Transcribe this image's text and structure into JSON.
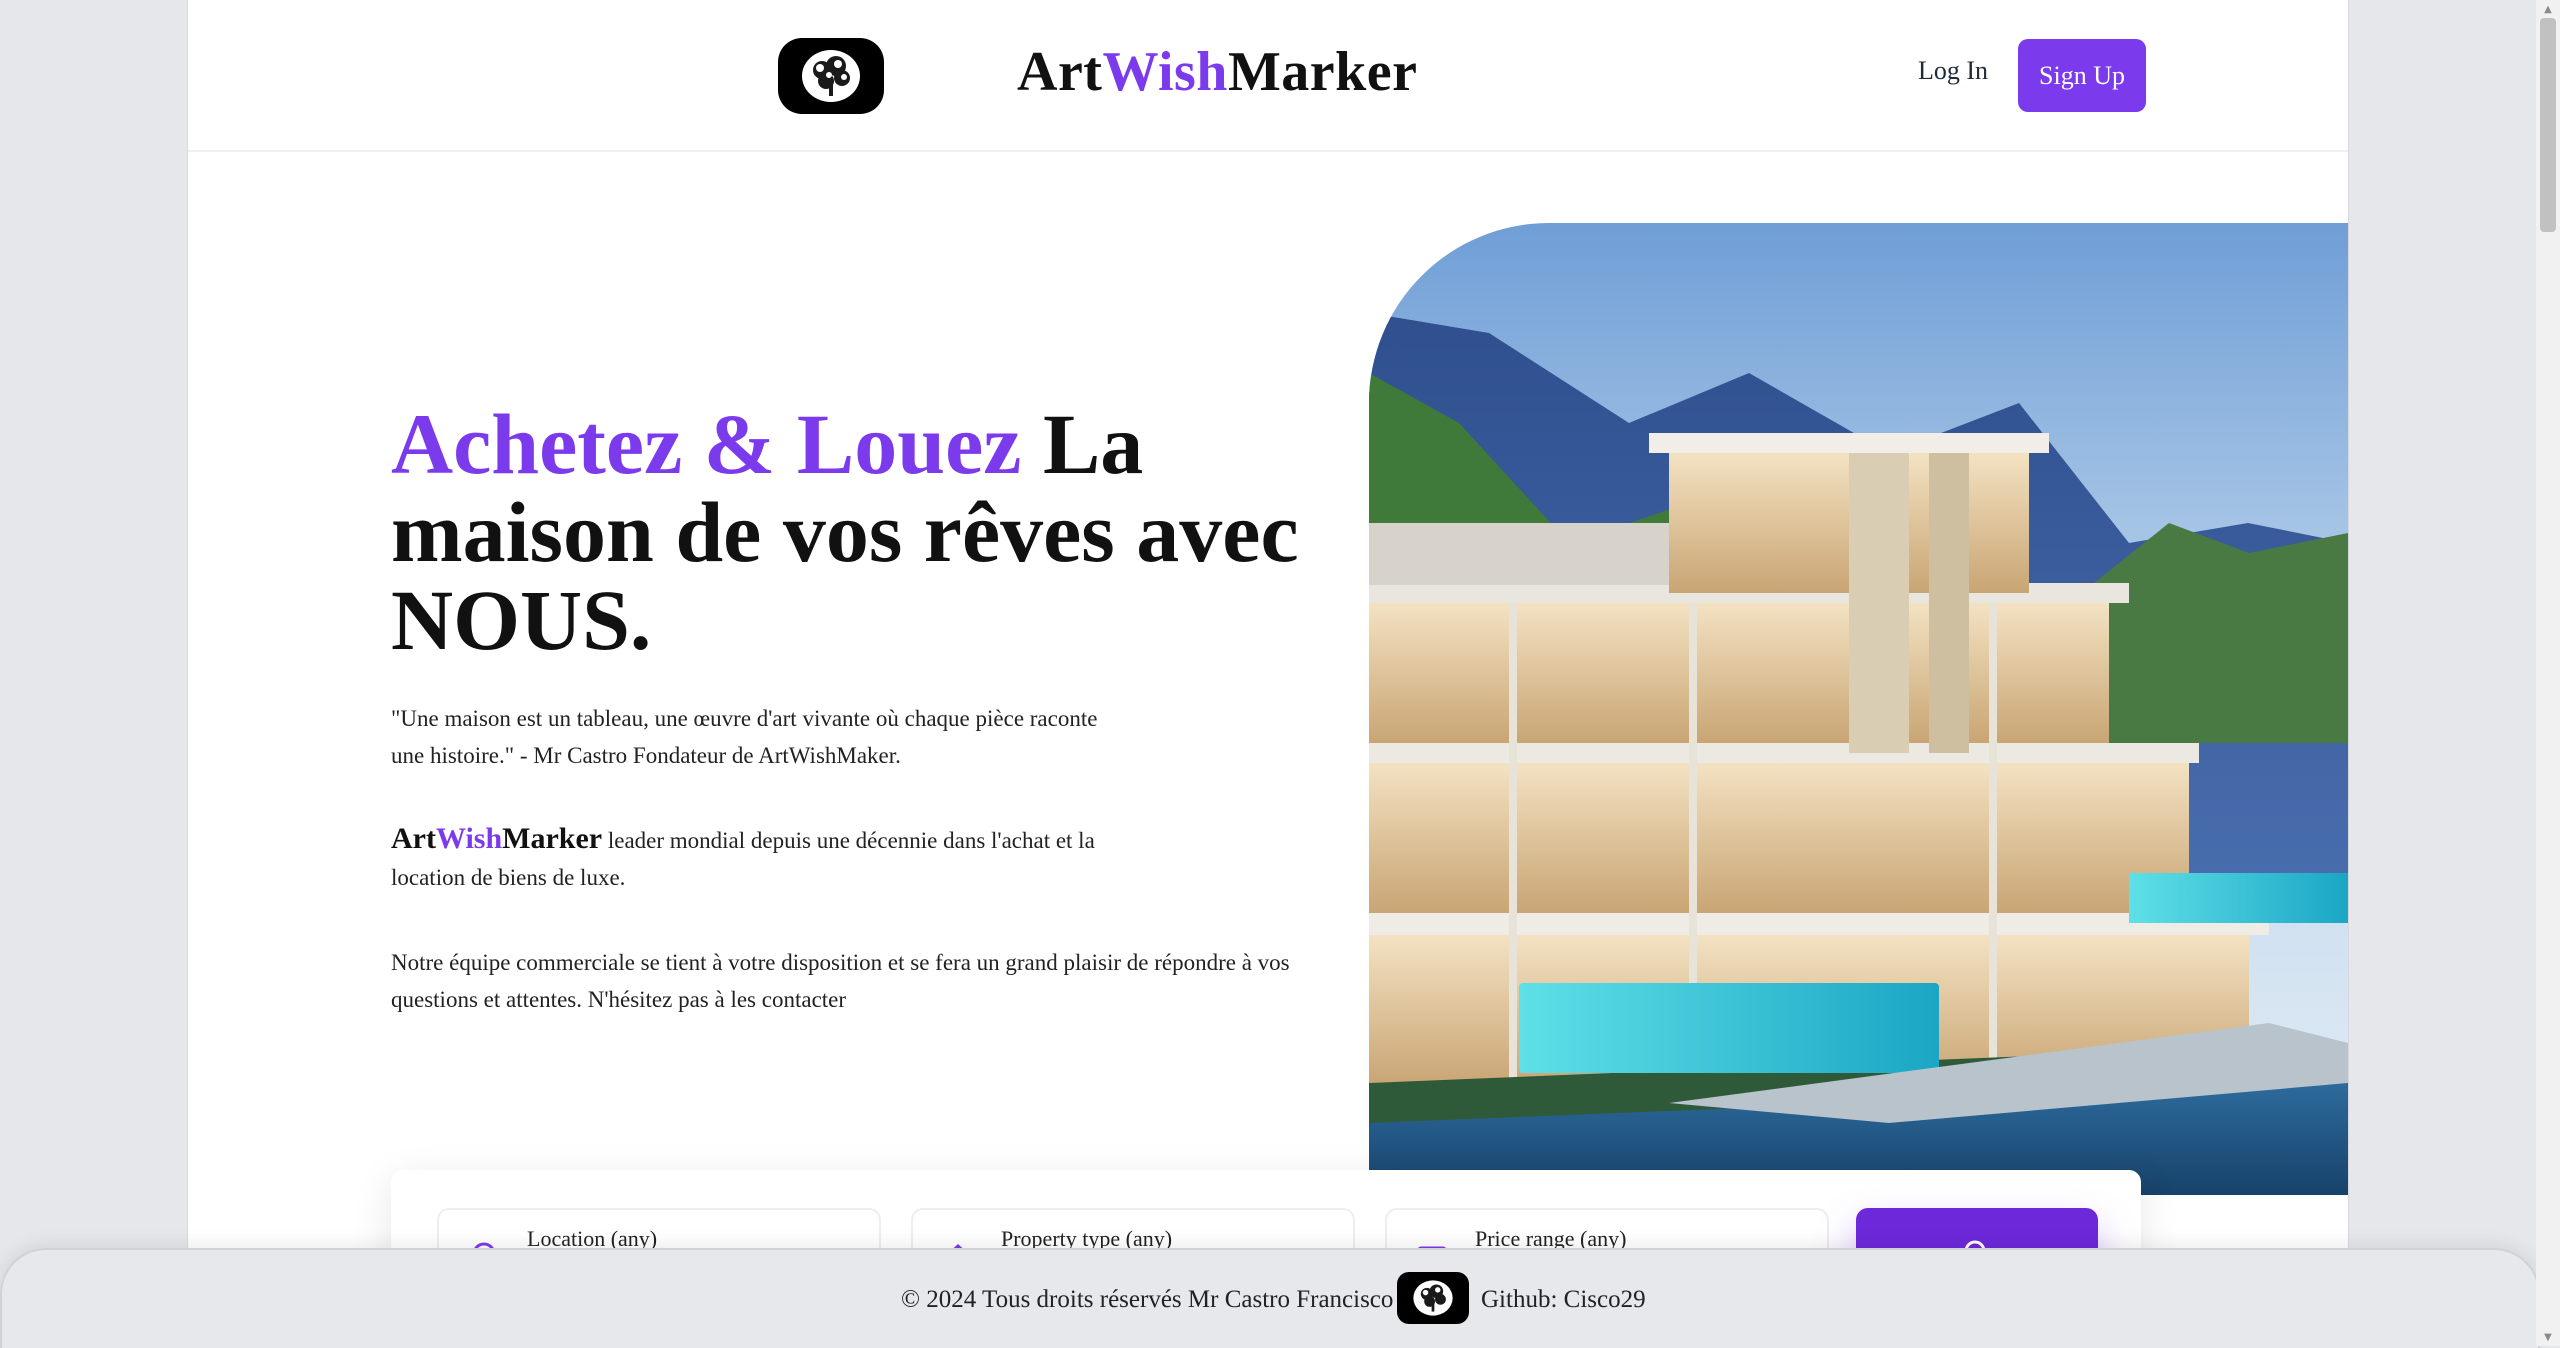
{
  "header": {
    "brand": {
      "part1": "Art",
      "part2": "Wish",
      "part3": "Marker"
    },
    "login_label": "Log In",
    "signup_label": "Sign Up"
  },
  "hero": {
    "title_accent": "Achetez & Louez",
    "title_rest": "La maison de vos rêves avec NOUS.",
    "quote": "\"Une maison est un tableau, une œuvre d'art vivante où chaque pièce raconte une histoire.\" - Mr Castro Fondateur de ArtWishMaker.",
    "leader_brand": {
      "part1": "Art",
      "part2": "Wish",
      "part3": "Marker"
    },
    "leader_text": "leader mondial depuis une décennie dans l'achat et la location de biens de luxe.",
    "team_text": "Notre équipe commerciale se tient à votre disposition et se fera un grand plaisir de répondre à vos questions et attentes. N'hésitez pas à les contacter"
  },
  "search": {
    "location_label": "Location (any)",
    "property_label": "Property type (any)",
    "price_label": "Price range (any)",
    "location_icon": "map-pin-icon",
    "property_icon": "house-icon",
    "price_icon": "wallet-icon",
    "button_icon": "search-icon"
  },
  "footer": {
    "copyright": "© 2024 Tous droits réservés Mr Castro Francisco",
    "github": "Github: Cisco29"
  },
  "colors": {
    "accent": "#7c3aed",
    "button": "#6d28d9",
    "background": "#e5e7eb"
  }
}
